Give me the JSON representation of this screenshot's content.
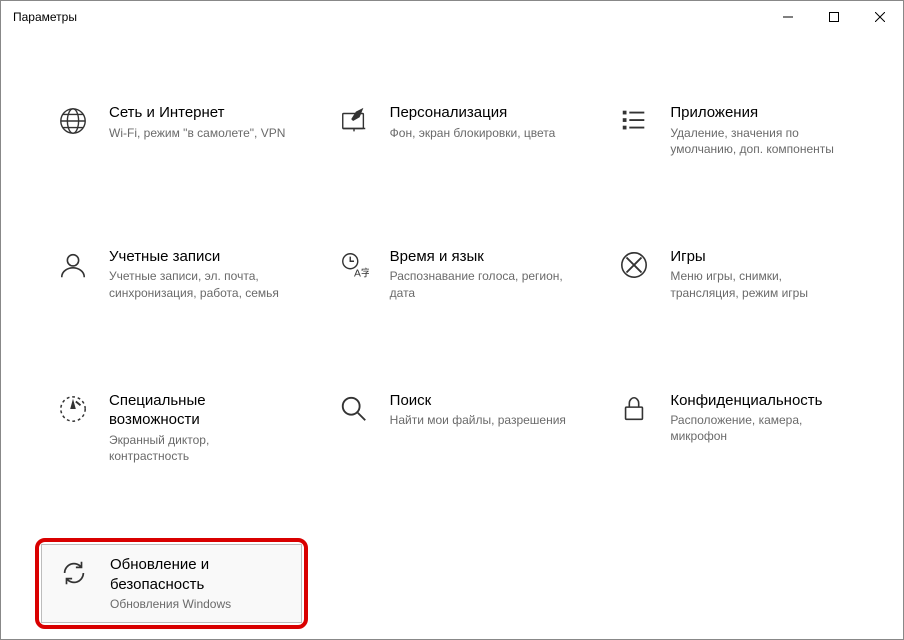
{
  "window": {
    "title": "Параметры"
  },
  "tiles": {
    "network": {
      "title": "Сеть и Интернет",
      "subtitle": "Wi-Fi, режим \"в самолете\", VPN"
    },
    "personal": {
      "title": "Персонализация",
      "subtitle": "Фон, экран блокировки, цвета"
    },
    "apps": {
      "title": "Приложения",
      "subtitle": "Удаление, значения по умолчанию, доп. компоненты"
    },
    "accounts": {
      "title": "Учетные записи",
      "subtitle": "Учетные записи, эл. почта, синхронизация, работа, семья"
    },
    "time": {
      "title": "Время и язык",
      "subtitle": "Распознавание голоса, регион, дата"
    },
    "gaming": {
      "title": "Игры",
      "subtitle": "Меню игры, снимки, трансляция, режим игры"
    },
    "ease": {
      "title": "Специальные возможности",
      "subtitle": "Экранный диктор, контрастность"
    },
    "search": {
      "title": "Поиск",
      "subtitle": "Найти мои файлы, разрешения"
    },
    "privacy": {
      "title": "Конфиденциальность",
      "subtitle": "Расположение, камера, микрофон"
    },
    "update": {
      "title": "Обновление и безопасность",
      "subtitle": "Обновления Windows"
    }
  }
}
